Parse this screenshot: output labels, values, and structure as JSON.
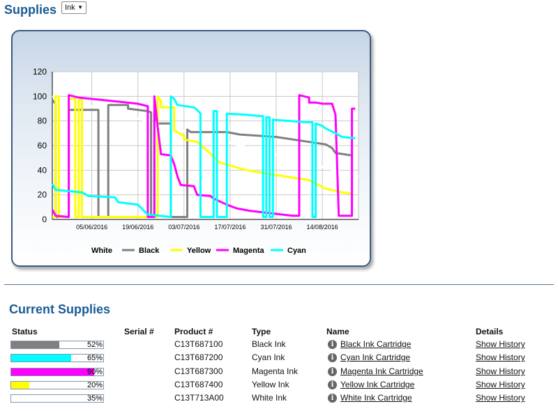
{
  "header": {
    "title": "Supplies",
    "filter_value": "Ink"
  },
  "section": {
    "title": "Current Supplies"
  },
  "table": {
    "headers": {
      "status": "Status",
      "serial": "Serial #",
      "product": "Product #",
      "type": "Type",
      "name": "Name",
      "details": "Details"
    },
    "rows": [
      {
        "level": 52,
        "level_label": "52%",
        "color": "#808080",
        "product": "C13T687100",
        "type": "Black Ink",
        "name": "Black Ink Cartridge",
        "details": "Show History"
      },
      {
        "level": 65,
        "level_label": "65%",
        "color": "#00ffff",
        "product": "C13T687200",
        "type": "Cyan Ink",
        "name": "Cyan Ink Cartridge",
        "details": "Show History"
      },
      {
        "level": 90,
        "level_label": "90%",
        "color": "#ff00ff",
        "product": "C13T687300",
        "type": "Magenta Ink",
        "name": "Magenta Ink Cartridge",
        "details": "Show History"
      },
      {
        "level": 20,
        "level_label": "20%",
        "color": "#ffff00",
        "product": "C13T687400",
        "type": "Yellow Ink",
        "name": "Yellow Ink Cartridge",
        "details": "Show History"
      },
      {
        "level": 35,
        "level_label": "35%",
        "color": "#ffffff",
        "product": "C13T713A00",
        "type": "White Ink",
        "name": "White Ink Cartridge",
        "details": "Show History"
      }
    ]
  },
  "chart_data": {
    "type": "line",
    "title": "",
    "xlabel": "",
    "ylabel": "",
    "ylim": [
      0,
      120
    ],
    "yticks": [
      "0",
      "20",
      "40",
      "60",
      "80",
      "100",
      "120"
    ],
    "xlim": [
      "2016-05-24",
      "2016-08-25"
    ],
    "xticks": [
      {
        "date": "2016-06-05",
        "label": "05/06/2016"
      },
      {
        "date": "2016-06-19",
        "label": "19/06/2016"
      },
      {
        "date": "2016-07-03",
        "label": "03/07/2016"
      },
      {
        "date": "2016-07-17",
        "label": "17/07/2016"
      },
      {
        "date": "2016-07-31",
        "label": "31/07/2016"
      },
      {
        "date": "2016-08-14",
        "label": "14/08/2016"
      }
    ],
    "grid": true,
    "legend_position": "bottom",
    "series": [
      {
        "name": "White",
        "color": "#ffffff",
        "points": [
          [
            "2016-05-24",
            100
          ],
          [
            "2016-08-25",
            35
          ]
        ]
      },
      {
        "name": "Black",
        "color": "#808080",
        "points": [
          [
            "2016-05-24",
            97
          ],
          [
            "2016-05-25",
            94
          ],
          [
            "2016-05-25",
            2
          ],
          [
            "2016-05-29",
            2
          ],
          [
            "2016-05-29",
            89
          ],
          [
            "2016-06-07",
            89
          ],
          [
            "2016-06-07",
            2
          ],
          [
            "2016-06-10",
            2
          ],
          [
            "2016-06-10",
            93
          ],
          [
            "2016-06-16",
            93
          ],
          [
            "2016-06-16",
            90
          ],
          [
            "2016-06-22",
            88
          ],
          [
            "2016-06-23",
            87
          ],
          [
            "2016-06-23",
            2
          ],
          [
            "2016-06-24",
            2
          ],
          [
            "2016-06-24",
            85
          ],
          [
            "2016-06-25",
            78
          ],
          [
            "2016-06-29",
            78
          ],
          [
            "2016-06-29",
            2
          ],
          [
            "2016-07-04",
            2
          ],
          [
            "2016-07-04",
            73
          ],
          [
            "2016-07-05",
            71
          ],
          [
            "2016-07-16",
            71
          ],
          [
            "2016-07-20",
            69
          ],
          [
            "2016-07-31",
            67
          ],
          [
            "2016-08-10",
            63
          ],
          [
            "2016-08-15",
            61
          ],
          [
            "2016-08-17",
            58
          ],
          [
            "2016-08-18",
            54
          ],
          [
            "2016-08-23",
            52
          ]
        ]
      },
      {
        "name": "Yellow",
        "color": "#ffff00",
        "points": [
          [
            "2016-05-24",
            2
          ],
          [
            "2016-05-25",
            2
          ],
          [
            "2016-05-25",
            100
          ],
          [
            "2016-05-26",
            100
          ],
          [
            "2016-05-26",
            2
          ],
          [
            "2016-05-29",
            2
          ],
          [
            "2016-05-29",
            98
          ],
          [
            "2016-05-31",
            98
          ],
          [
            "2016-05-31",
            2
          ],
          [
            "2016-06-01",
            2
          ],
          [
            "2016-06-01",
            97
          ],
          [
            "2016-06-02",
            97
          ],
          [
            "2016-06-02",
            2
          ],
          [
            "2016-06-25",
            2
          ],
          [
            "2016-06-25",
            100
          ],
          [
            "2016-06-26",
            96
          ],
          [
            "2016-06-26",
            91
          ],
          [
            "2016-06-30",
            91
          ],
          [
            "2016-06-30",
            72
          ],
          [
            "2016-07-03",
            68
          ],
          [
            "2016-07-03",
            65
          ],
          [
            "2016-07-07",
            63
          ],
          [
            "2016-07-10",
            56
          ],
          [
            "2016-07-14",
            46
          ],
          [
            "2016-07-22",
            40
          ],
          [
            "2016-07-31",
            36
          ],
          [
            "2016-08-10",
            32
          ],
          [
            "2016-08-15",
            25
          ],
          [
            "2016-08-20",
            22
          ],
          [
            "2016-08-23",
            21
          ]
        ]
      },
      {
        "name": "Magenta",
        "color": "#ff00ff",
        "points": [
          [
            "2016-05-24",
            8
          ],
          [
            "2016-05-25",
            3
          ],
          [
            "2016-05-29",
            2
          ],
          [
            "2016-05-29",
            101
          ],
          [
            "2016-06-01",
            99
          ],
          [
            "2016-06-12",
            96
          ],
          [
            "2016-06-19",
            94
          ],
          [
            "2016-06-22",
            92
          ],
          [
            "2016-06-22",
            2
          ],
          [
            "2016-06-24",
            2
          ],
          [
            "2016-06-24",
            100
          ],
          [
            "2016-06-25",
            75
          ],
          [
            "2016-06-26",
            53
          ],
          [
            "2016-06-29",
            52
          ],
          [
            "2016-06-30",
            45
          ],
          [
            "2016-07-01",
            35
          ],
          [
            "2016-07-02",
            28
          ],
          [
            "2016-07-06",
            27
          ],
          [
            "2016-07-07",
            20
          ],
          [
            "2016-07-11",
            19
          ],
          [
            "2016-07-12",
            17
          ],
          [
            "2016-07-16",
            12
          ],
          [
            "2016-07-19",
            9
          ],
          [
            "2016-07-23",
            7
          ],
          [
            "2016-08-05",
            3
          ],
          [
            "2016-08-07",
            3
          ],
          [
            "2016-08-07",
            101
          ],
          [
            "2016-08-10",
            99
          ],
          [
            "2016-08-10",
            95
          ],
          [
            "2016-08-12",
            95
          ],
          [
            "2016-08-14",
            94
          ],
          [
            "2016-08-17",
            94
          ],
          [
            "2016-08-18",
            85
          ],
          [
            "2016-08-19",
            3
          ],
          [
            "2016-08-23",
            3
          ],
          [
            "2016-08-23",
            90
          ],
          [
            "2016-08-24",
            90
          ]
        ]
      },
      {
        "name": "Cyan",
        "color": "#00ffff",
        "points": [
          [
            "2016-05-24",
            29
          ],
          [
            "2016-05-25",
            24
          ],
          [
            "2016-06-02",
            22
          ],
          [
            "2016-06-04",
            19
          ],
          [
            "2016-06-12",
            18
          ],
          [
            "2016-06-13",
            14
          ],
          [
            "2016-06-19",
            12
          ],
          [
            "2016-06-22",
            4
          ],
          [
            "2016-06-29",
            2
          ],
          [
            "2016-06-29",
            100
          ],
          [
            "2016-06-30",
            98
          ],
          [
            "2016-07-01",
            93
          ],
          [
            "2016-07-06",
            91
          ],
          [
            "2016-07-07",
            89
          ],
          [
            "2016-07-08",
            86
          ],
          [
            "2016-07-08",
            2
          ],
          [
            "2016-07-12",
            2
          ],
          [
            "2016-07-12",
            88
          ],
          [
            "2016-07-13",
            88
          ],
          [
            "2016-07-13",
            2
          ],
          [
            "2016-07-16",
            2
          ],
          [
            "2016-07-16",
            86
          ],
          [
            "2016-07-22",
            85
          ],
          [
            "2016-07-26",
            84
          ],
          [
            "2016-07-27",
            84
          ],
          [
            "2016-07-27",
            2
          ],
          [
            "2016-07-28",
            2
          ],
          [
            "2016-07-28",
            83
          ],
          [
            "2016-07-29",
            83
          ],
          [
            "2016-07-29",
            2
          ],
          [
            "2016-07-30",
            2
          ],
          [
            "2016-07-30",
            81
          ],
          [
            "2016-08-09",
            79
          ],
          [
            "2016-08-11",
            79
          ],
          [
            "2016-08-11",
            2
          ],
          [
            "2016-08-12",
            2
          ],
          [
            "2016-08-12",
            78
          ],
          [
            "2016-08-14",
            76
          ],
          [
            "2016-08-15",
            74
          ],
          [
            "2016-08-18",
            70
          ],
          [
            "2016-08-20",
            67
          ],
          [
            "2016-08-24",
            66
          ]
        ]
      }
    ]
  }
}
